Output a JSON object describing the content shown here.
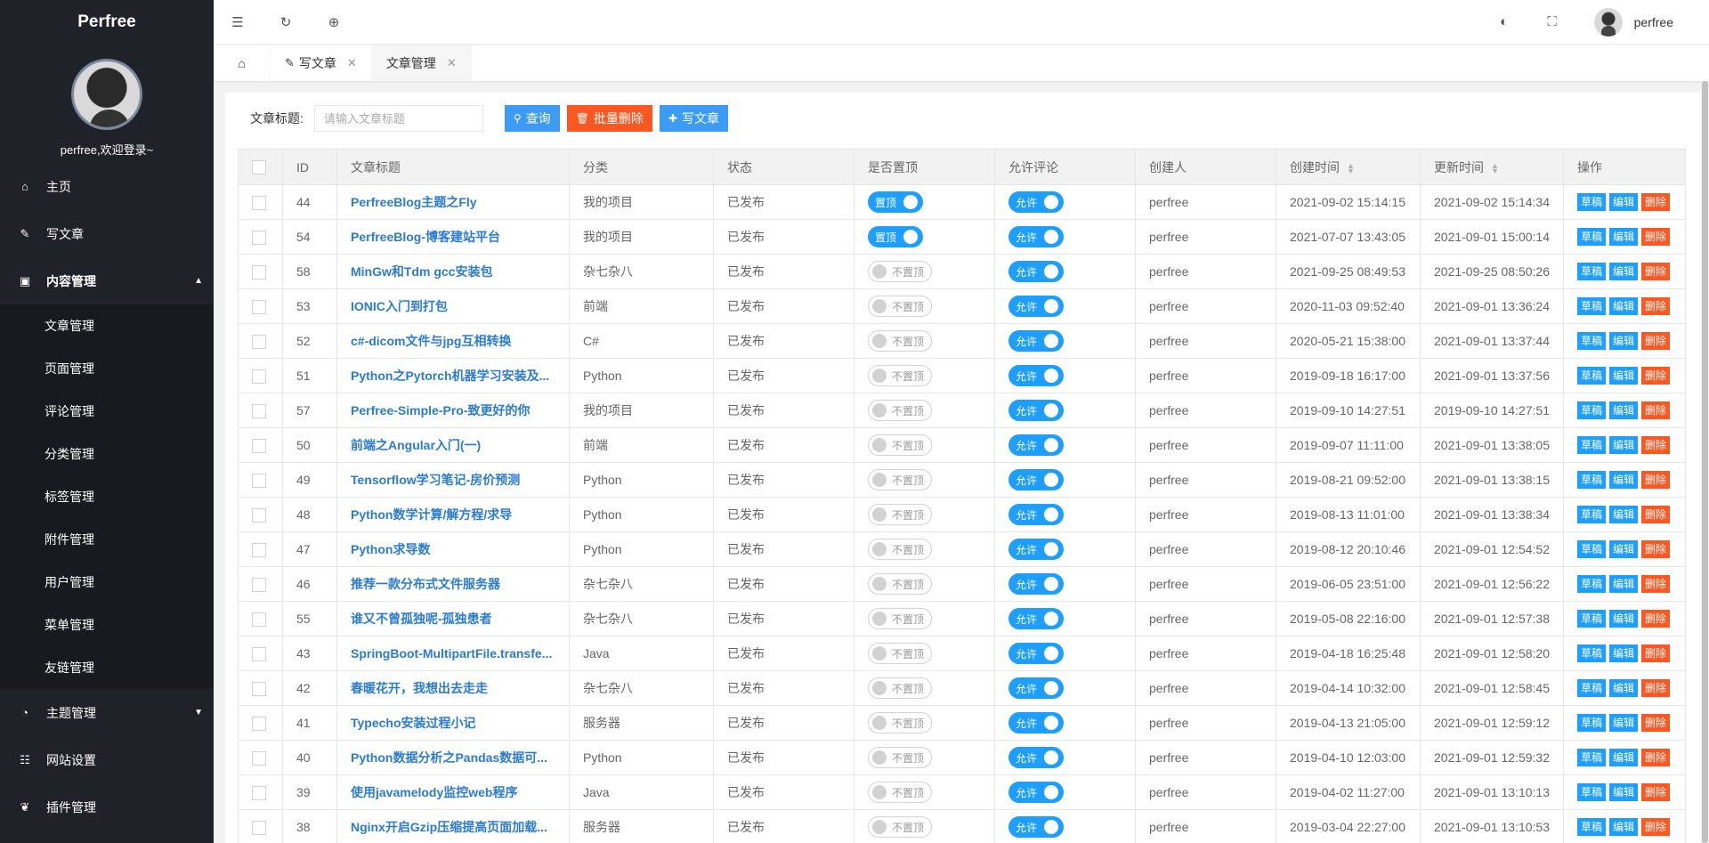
{
  "app": {
    "brand": "Perfree",
    "welcome": "perfree,欢迎登录~"
  },
  "sidebar": {
    "items": [
      {
        "label": "主页",
        "icon": "home-icon"
      },
      {
        "label": "写文章",
        "icon": "edit-icon"
      },
      {
        "label": "内容管理",
        "icon": "inbox-icon",
        "open": true
      }
    ],
    "submenu": [
      "文章管理",
      "页面管理",
      "评论管理",
      "分类管理",
      "标签管理",
      "附件管理",
      "用户管理",
      "菜单管理",
      "友链管理"
    ],
    "after": [
      {
        "label": "主题管理",
        "icon": "dashboard-icon",
        "caret": true
      },
      {
        "label": "网站设置",
        "icon": "sliders-icon"
      },
      {
        "label": "插件管理",
        "icon": "leaf-icon"
      }
    ]
  },
  "header": {
    "username": "perfree"
  },
  "tabs": [
    {
      "label": "写文章",
      "icon": "edit-icon",
      "close": "✕"
    },
    {
      "label": "文章管理",
      "close": "✕"
    }
  ],
  "search": {
    "label": "文章标题:",
    "placeholder": "请输入文章标题",
    "query_label": "查询",
    "batch_delete_label": "批量删除",
    "write_label": "写文章"
  },
  "table": {
    "headers": [
      "ID",
      "文章标题",
      "分类",
      "状态",
      "是否置顶",
      "允许评论",
      "创建人",
      "创建时间",
      "更新时间",
      "操作"
    ],
    "top_on_label": "置顶",
    "top_off_label": "不置顶",
    "comment_on_label": "允许",
    "op_draft": "草稿",
    "op_edit": "编辑",
    "op_delete": "删除",
    "rows": [
      {
        "id": "44",
        "title": "PerfreeBlog主题之Fly",
        "category": "我的项目",
        "status": "已发布",
        "top": true,
        "creator": "perfree",
        "created": "2021-09-02 15:14:15",
        "updated": "2021-09-02 15:14:34"
      },
      {
        "id": "54",
        "title": "PerfreeBlog-博客建站平台",
        "category": "我的项目",
        "status": "已发布",
        "top": true,
        "creator": "perfree",
        "created": "2021-07-07 13:43:05",
        "updated": "2021-09-01 15:00:14"
      },
      {
        "id": "58",
        "title": "MinGw和Tdm gcc安装包",
        "category": "杂七杂八",
        "status": "已发布",
        "top": false,
        "creator": "perfree",
        "created": "2021-09-25 08:49:53",
        "updated": "2021-09-25 08:50:26"
      },
      {
        "id": "53",
        "title": "IONIC入门到打包",
        "category": "前端",
        "status": "已发布",
        "top": false,
        "creator": "perfree",
        "created": "2020-11-03 09:52:40",
        "updated": "2021-09-01 13:36:24"
      },
      {
        "id": "52",
        "title": "c#-dicom文件与jpg互相转换",
        "category": "C#",
        "status": "已发布",
        "top": false,
        "creator": "perfree",
        "created": "2020-05-21 15:38:00",
        "updated": "2021-09-01 13:37:44"
      },
      {
        "id": "51",
        "title": "Python之Pytorch机器学习安装及...",
        "category": "Python",
        "status": "已发布",
        "top": false,
        "creator": "perfree",
        "created": "2019-09-18 16:17:00",
        "updated": "2021-09-01 13:37:56"
      },
      {
        "id": "57",
        "title": "Perfree-Simple-Pro-致更好的你",
        "category": "我的项目",
        "status": "已发布",
        "top": false,
        "creator": "perfree",
        "created": "2019-09-10 14:27:51",
        "updated": "2019-09-10 14:27:51"
      },
      {
        "id": "50",
        "title": "前端之Angular入门(一)",
        "category": "前端",
        "status": "已发布",
        "top": false,
        "creator": "perfree",
        "created": "2019-09-07 11:11:00",
        "updated": "2021-09-01 13:38:05"
      },
      {
        "id": "49",
        "title": "Tensorflow学习笔记-房价预测",
        "category": "Python",
        "status": "已发布",
        "top": false,
        "creator": "perfree",
        "created": "2019-08-21 09:52:00",
        "updated": "2021-09-01 13:38:15"
      },
      {
        "id": "48",
        "title": "Python数学计算/解方程/求导",
        "category": "Python",
        "status": "已发布",
        "top": false,
        "creator": "perfree",
        "created": "2019-08-13 11:01:00",
        "updated": "2021-09-01 13:38:34"
      },
      {
        "id": "47",
        "title": "Python求导数",
        "category": "Python",
        "status": "已发布",
        "top": false,
        "creator": "perfree",
        "created": "2019-08-12 20:10:46",
        "updated": "2021-09-01 12:54:52"
      },
      {
        "id": "46",
        "title": "推荐一款分布式文件服务器",
        "category": "杂七杂八",
        "status": "已发布",
        "top": false,
        "creator": "perfree",
        "created": "2019-06-05 23:51:00",
        "updated": "2021-09-01 12:56:22"
      },
      {
        "id": "55",
        "title": "谁又不曾孤独呢-孤独患者",
        "category": "杂七杂八",
        "status": "已发布",
        "top": false,
        "creator": "perfree",
        "created": "2019-05-08 22:16:00",
        "updated": "2021-09-01 12:57:38"
      },
      {
        "id": "43",
        "title": "SpringBoot-MultipartFile.transfe...",
        "category": "Java",
        "status": "已发布",
        "top": false,
        "creator": "perfree",
        "created": "2019-04-18 16:25:48",
        "updated": "2021-09-01 12:58:20"
      },
      {
        "id": "42",
        "title": "春暖花开，我想出去走走",
        "category": "杂七杂八",
        "status": "已发布",
        "top": false,
        "creator": "perfree",
        "created": "2019-04-14 10:32:00",
        "updated": "2021-09-01 12:58:45"
      },
      {
        "id": "41",
        "title": "Typecho安装过程小记",
        "category": "服务器",
        "status": "已发布",
        "top": false,
        "creator": "perfree",
        "created": "2019-04-13 21:05:00",
        "updated": "2021-09-01 12:59:12"
      },
      {
        "id": "40",
        "title": "Python数据分析之Pandas数据可...",
        "category": "Python",
        "status": "已发布",
        "top": false,
        "creator": "perfree",
        "created": "2019-04-10 12:03:00",
        "updated": "2021-09-01 12:59:32"
      },
      {
        "id": "39",
        "title": "使用javamelody监控web程序",
        "category": "Java",
        "status": "已发布",
        "top": false,
        "creator": "perfree",
        "created": "2019-04-02 11:27:00",
        "updated": "2021-09-01 13:10:13"
      },
      {
        "id": "38",
        "title": "Nginx开启Gzip压缩提高页面加载...",
        "category": "服务器",
        "status": "已发布",
        "top": false,
        "creator": "perfree",
        "created": "2019-03-04 22:27:00",
        "updated": "2021-09-01 13:10:53"
      }
    ]
  },
  "colors": {
    "sidebar_bg": "#20222a",
    "primary": "#1e9fff",
    "danger": "#ff5722"
  }
}
